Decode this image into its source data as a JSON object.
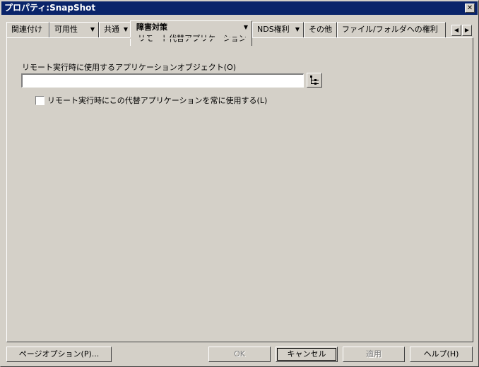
{
  "window": {
    "title": "プロパティ:SnapShot",
    "close_symbol": "✕"
  },
  "tabs": [
    {
      "label": "関連付け",
      "arrow": ""
    },
    {
      "label": "可用性",
      "arrow": "▼"
    },
    {
      "label": "共通",
      "arrow": "▼"
    },
    {
      "label": "障害対策",
      "sub": "リモート代替アプリケーション",
      "arrow": "▼",
      "active": true
    },
    {
      "label": "NDS権利",
      "arrow": "▼"
    },
    {
      "label": "その他",
      "arrow": ""
    },
    {
      "label": "ファイル/フォルダへの権利",
      "arrow": ""
    }
  ],
  "tab_scroll": {
    "left": "◀",
    "right": "▶"
  },
  "form": {
    "object_label": "リモート実行時に使用するアプリケーションオブジェクト(O)",
    "object_value": "",
    "always_use_label": "リモート実行時にこの代替アプリケーションを常に使用する(L)",
    "always_use_checked": false
  },
  "buttons": {
    "page_options": "ページオプション(P)...",
    "ok": "OK",
    "cancel": "キャンセル",
    "apply": "適用",
    "help": "ヘルプ(H)"
  }
}
